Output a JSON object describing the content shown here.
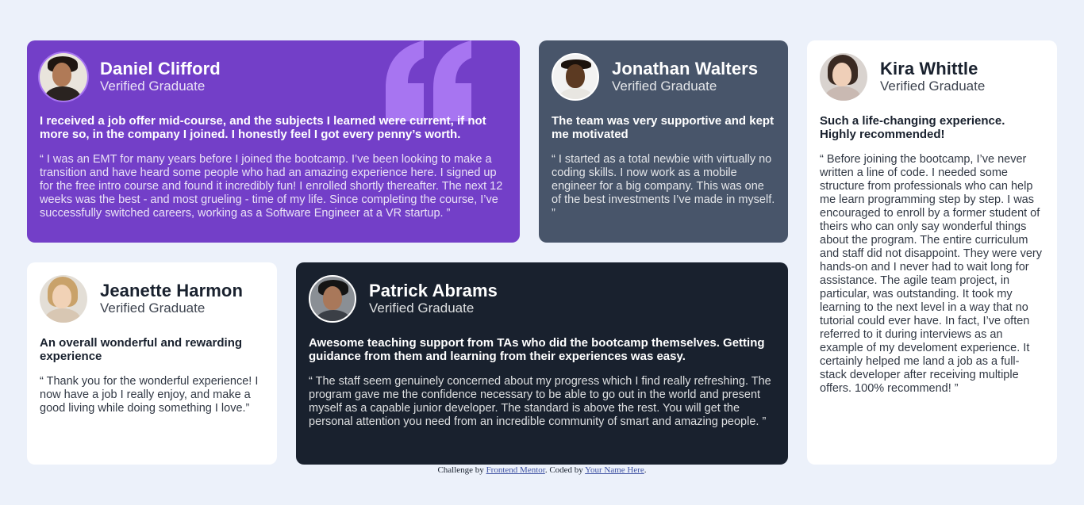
{
  "testimonials": [
    {
      "name": "Daniel Clifford",
      "status": "Verified Graduate",
      "headline": "I received a job offer mid-course, and the subjects I learned were current, if not more so, in the company I joined. I honestly feel I got every penny’s worth.",
      "quote": "“ I was an EMT for many years before I joined the bootcamp. I’ve been looking to make a transition and have heard some people who had an amazing experience here. I signed up for the free intro course and found it incredibly fun! I enrolled shortly thereafter. The next 12 weeks was the best - and most grueling - time of my life. Since completing the course, I’ve successfully switched careers, working as a Software Engineer at a VR startup. ”"
    },
    {
      "name": "Jonathan Walters",
      "status": "Verified Graduate",
      "headline": "The team was very supportive and kept me motivated",
      "quote": "“ I started as a total newbie with virtually no coding skills. I now work as a mobile engineer for a big company. This was one of the best investments I’ve made in myself. ”"
    },
    {
      "name": "Kira Whittle",
      "status": "Verified Graduate",
      "headline": "Such a life-changing experience. Highly recommended!",
      "quote": "“ Before joining the bootcamp, I’ve never written a line of code. I needed some structure from professionals who can help me learn programming step by step. I was encouraged to enroll by a former student of theirs who can only say wonderful things about the program. The entire curriculum and staff did not disappoint. They were very hands-on and I never had to wait long for assistance. The agile team project, in particular, was outstanding. It took my learning to the next level in a way that no tutorial could ever have. In fact, I’ve often referred to it during interviews as an example of my develoment experience. It certainly helped me land a job as a full-stack developer after receiving multiple offers. 100% recommend! ”"
    },
    {
      "name": "Jeanette Harmon",
      "status": "Verified Graduate",
      "headline": "An overall wonderful and rewarding experience",
      "quote": "“ Thank you for the wonderful experience! I now have a job I really enjoy, and make a good living while doing something I love.”"
    },
    {
      "name": "Patrick Abrams",
      "status": "Verified Graduate",
      "headline": "Awesome teaching support from TAs who did the bootcamp themselves. Getting guidance from them and learning from their experiences was easy.",
      "quote": "“ The staff seem genuinely concerned about my progress which I find really refreshing. The program gave me the confidence necessary to be able to go out in the world and present myself as a capable junior developer. The standard is above the rest. You will get the personal attention you need from an incredible community of smart and amazing people. ”"
    }
  ],
  "footer": {
    "prefix": "Challenge by ",
    "link1": "Frontend Mentor",
    "middle": ". Coded by ",
    "link2": "Your Name Here",
    "suffix": "."
  },
  "colors": {
    "page_bg": "#ecf1fa",
    "purple": "#733fc8",
    "gray_blue": "#48556a",
    "dark": "#19212e",
    "white": "#ffffff",
    "quote_icon": "#a775f1"
  }
}
